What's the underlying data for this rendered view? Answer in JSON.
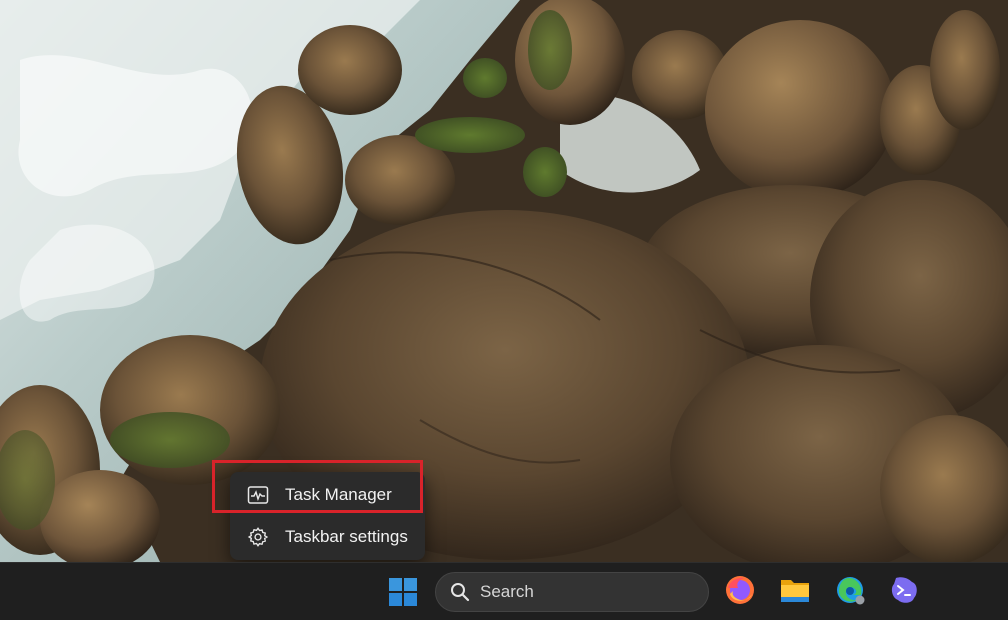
{
  "context_menu": {
    "items": [
      {
        "label": "Task Manager",
        "icon": "task-manager-icon"
      },
      {
        "label": "Taskbar settings",
        "icon": "gear-icon"
      }
    ],
    "highlight_color": "#d9232a"
  },
  "taskbar": {
    "search": {
      "label": "Search",
      "icon": "search-icon"
    },
    "apps": [
      {
        "name": "firefox",
        "icon": "firefox-icon"
      },
      {
        "name": "file-explorer",
        "icon": "folder-icon"
      },
      {
        "name": "microsoft-edge",
        "icon": "edge-icon"
      },
      {
        "name": "terminal-copilot",
        "icon": "terminal-icon"
      }
    ],
    "start_icon": "windows-logo-icon",
    "accent_color": "#2b88d8"
  }
}
